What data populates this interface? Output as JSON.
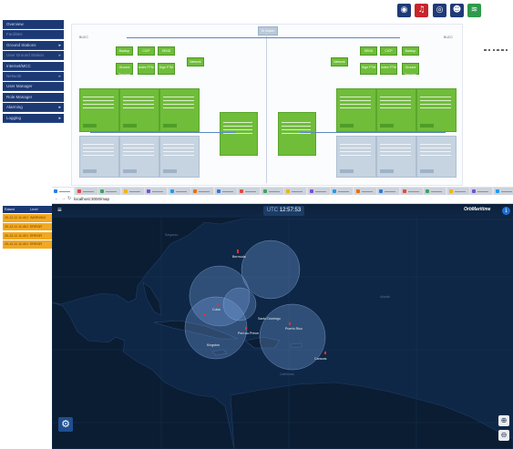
{
  "back_window": {
    "toolbar_icons": [
      "server-icon",
      "alarm-bell-icon",
      "shield-icon",
      "user-icon",
      "wifi-icon"
    ],
    "sidebar": {
      "items": [
        {
          "label": "Overview",
          "has_arrow": false,
          "dim": false
        },
        {
          "label": "Facilities",
          "has_arrow": false,
          "dim": true
        },
        {
          "label": "Ground Stations",
          "has_arrow": true,
          "dim": false
        },
        {
          "label": "User Ground Station",
          "has_arrow": true,
          "dim": true
        },
        {
          "label": "Internet/MCC",
          "has_arrow": false,
          "dim": false
        },
        {
          "label": "Network",
          "has_arrow": true,
          "dim": true
        },
        {
          "label": "User Manager",
          "has_arrow": false,
          "dim": false
        },
        {
          "label": "Role Manager",
          "has_arrow": false,
          "dim": false
        },
        {
          "label": "Alarming",
          "has_arrow": true,
          "dim": false
        },
        {
          "label": "Logging",
          "has_arrow": true,
          "dim": false
        }
      ]
    },
    "diagram": {
      "top_node": "IS Switch",
      "left_site": "BUCC",
      "right_site": "BUCC",
      "left_nodes": [
        "Backup",
        "CICP",
        "SEND",
        "Network",
        "Ground Services",
        "Index FTM",
        "Sign FTM"
      ],
      "right_nodes": [
        "Backup",
        "CICP",
        "SEND",
        "Network",
        "Ground Services",
        "Index FTM",
        "Sign FTM"
      ]
    }
  },
  "alarm_table": {
    "headers": [
      "Raised",
      "Level"
    ],
    "rows": [
      [
        "20-12-11 11:40:15",
        "WARNING"
      ],
      [
        "20-12-11 11:40:01",
        "ERROR"
      ],
      [
        "20-12-11 11:40:01",
        "ERROR"
      ],
      [
        "20-12-11 11:40:00",
        "ERROR"
      ]
    ]
  },
  "front_window": {
    "url": "localhost:3000/map",
    "utc_label": "UTC",
    "utc_time": "12:57:53",
    "brand": "OrbMaritime",
    "zoom_in_icon": "zoom-in-icon",
    "zoom_out_icon": "zoom-out-icon",
    "settings_icon": "gear-icon",
    "cities": [
      "Bermuda",
      "Cuba",
      "Santo Domingo",
      "Puerto Rico",
      "Port-au-Prince",
      "Kingston",
      "Caracas"
    ],
    "tab_count": 22
  },
  "colors": {
    "sidebar_bg": "#1d3973",
    "node_green": "#6fbd39",
    "node_grey": "#c6d3e0",
    "alarm_orange": "#f2a81f",
    "map_bg": "#0f2746",
    "coverage": "#6f9bd8"
  }
}
